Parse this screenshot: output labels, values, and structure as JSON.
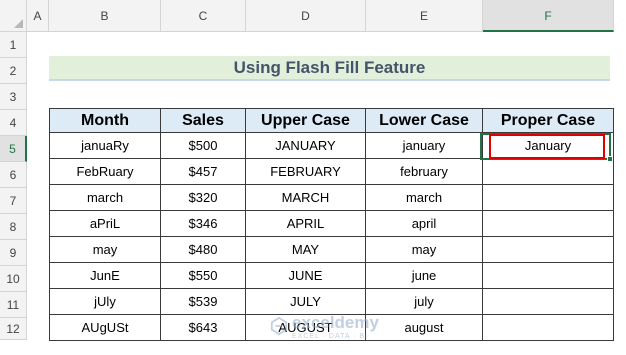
{
  "columns": [
    "A",
    "B",
    "C",
    "D",
    "E",
    "F"
  ],
  "rows": [
    "1",
    "2",
    "3",
    "4",
    "5",
    "6",
    "7",
    "8",
    "9",
    "10",
    "11",
    "12"
  ],
  "title": "Using Flash Fill Feature",
  "table": {
    "headers": [
      "Month",
      "Sales",
      "Upper Case",
      "Lower Case",
      "Proper Case"
    ],
    "rows": [
      [
        "januaRy",
        "$500",
        "JANUARY",
        "january",
        "January"
      ],
      [
        "FebRuary",
        "$457",
        "FEBRUARY",
        "february",
        ""
      ],
      [
        "march",
        "$320",
        "MARCH",
        "march",
        ""
      ],
      [
        "aPriL",
        "$346",
        "APRIL",
        "april",
        ""
      ],
      [
        "may",
        "$480",
        "MAY",
        "may",
        ""
      ],
      [
        "JunE",
        "$550",
        "JUNE",
        "june",
        ""
      ],
      [
        "jUly",
        "$539",
        "JULY",
        "july",
        ""
      ],
      [
        "AUgUSt",
        "$643",
        "AUGUST",
        "august",
        ""
      ]
    ]
  },
  "watermark": {
    "name": "exceldemy",
    "tagline": "EXCEL · DATA · BI"
  },
  "colors": {
    "accent": "#217346",
    "header_fill": "#ddebf7",
    "title_fill": "#e2efda",
    "title_text": "#44546a",
    "highlight": "#e00000"
  }
}
